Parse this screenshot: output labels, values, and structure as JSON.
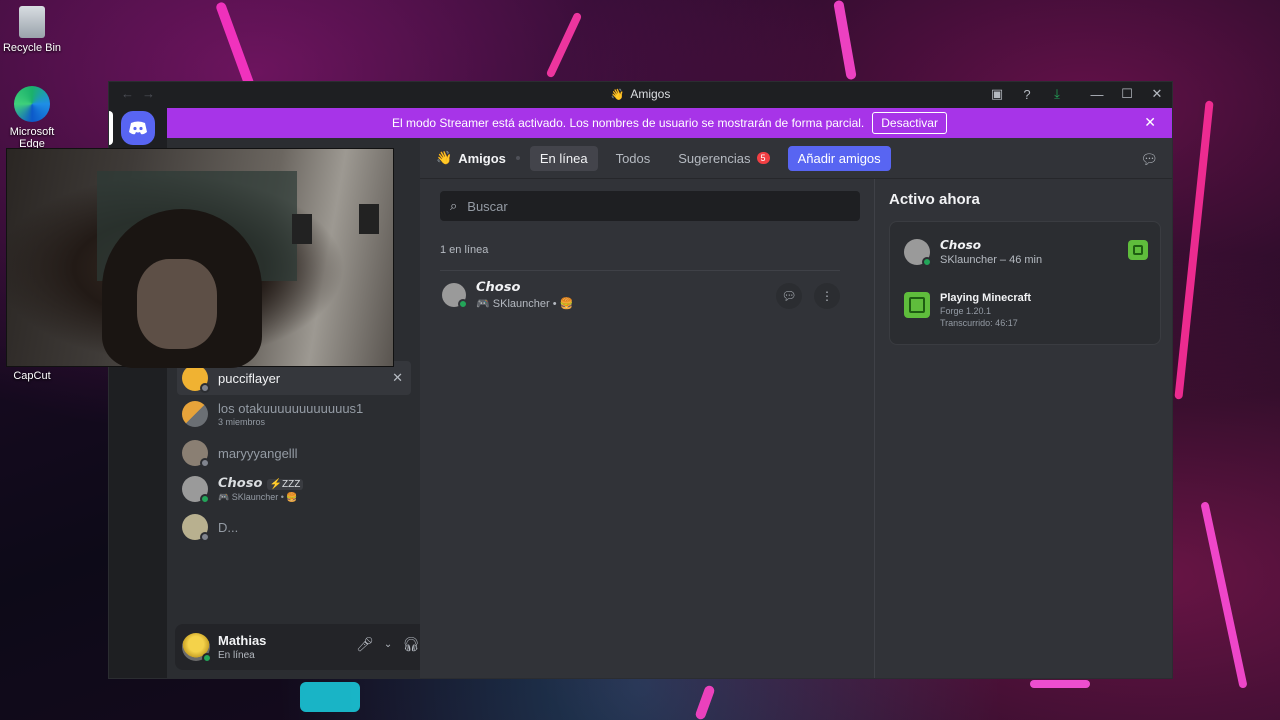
{
  "desktop": {
    "icons": [
      {
        "label": "Recycle Bin"
      },
      {
        "label": "Microsoft Edge"
      },
      {
        "label": "CapCut"
      }
    ]
  },
  "window": {
    "title": "Amigos",
    "buttons": [
      "inbox-screen",
      "help",
      "download",
      "minimize",
      "maximize",
      "close"
    ]
  },
  "banner": {
    "text": "El modo Streamer está activado. Los nombres de usuario se mostrarán de forma parcial.",
    "button": "Desactivar"
  },
  "sidebar": {
    "dms": [
      {
        "name": "pucciflayer",
        "sub": "",
        "status": "offline",
        "avatar_color": "#f0b232"
      },
      {
        "name": "los otakuuuuuuuuuuuus1",
        "sub": "3 miembros",
        "status": "none",
        "avatar_color": "#c97b2d"
      },
      {
        "name": "maryyyangelll",
        "sub": "",
        "status": "offline",
        "avatar_color": "#8a7f73"
      },
      {
        "name": "𝘾𝙝𝙤𝙨𝙤",
        "tag": "⚡ZZZ",
        "sub": "SKlauncher • 🍔",
        "status": "online",
        "avatar_color": "#9a9a9a"
      },
      {
        "name": "D...",
        "sub": "",
        "status": "offline",
        "avatar_color": "#b8b08f"
      }
    ],
    "user": {
      "name": "Mathias",
      "status": "En línea"
    }
  },
  "topbar": {
    "friends_label": "Amigos",
    "tabs": [
      {
        "label": "En línea",
        "active": true
      },
      {
        "label": "Todos",
        "active": false
      },
      {
        "label": "Sugerencias",
        "badge": "5",
        "active": false
      }
    ],
    "add_label": "Añadir amigos"
  },
  "friends": {
    "search_placeholder": "Buscar",
    "count_label": "1 en línea",
    "list": [
      {
        "name": "𝘾𝙝𝙤𝙨𝙤",
        "sub": "SKlauncher • 🍔",
        "status": "online"
      }
    ]
  },
  "active_now": {
    "heading": "Activo ahora",
    "card": {
      "name": "𝘾𝙝𝙤𝙨𝙤",
      "sub": "SKlauncher – 46 min",
      "playing": "Playing Minecraft",
      "detail": "Forge 1.20.1",
      "elapsed": "Transcurrido: 46:17"
    }
  },
  "colors": {
    "banner": "#a734e8",
    "brand": "#5865f2",
    "online": "#23a559",
    "offline": "#80848e",
    "badge": "#f23f43"
  }
}
